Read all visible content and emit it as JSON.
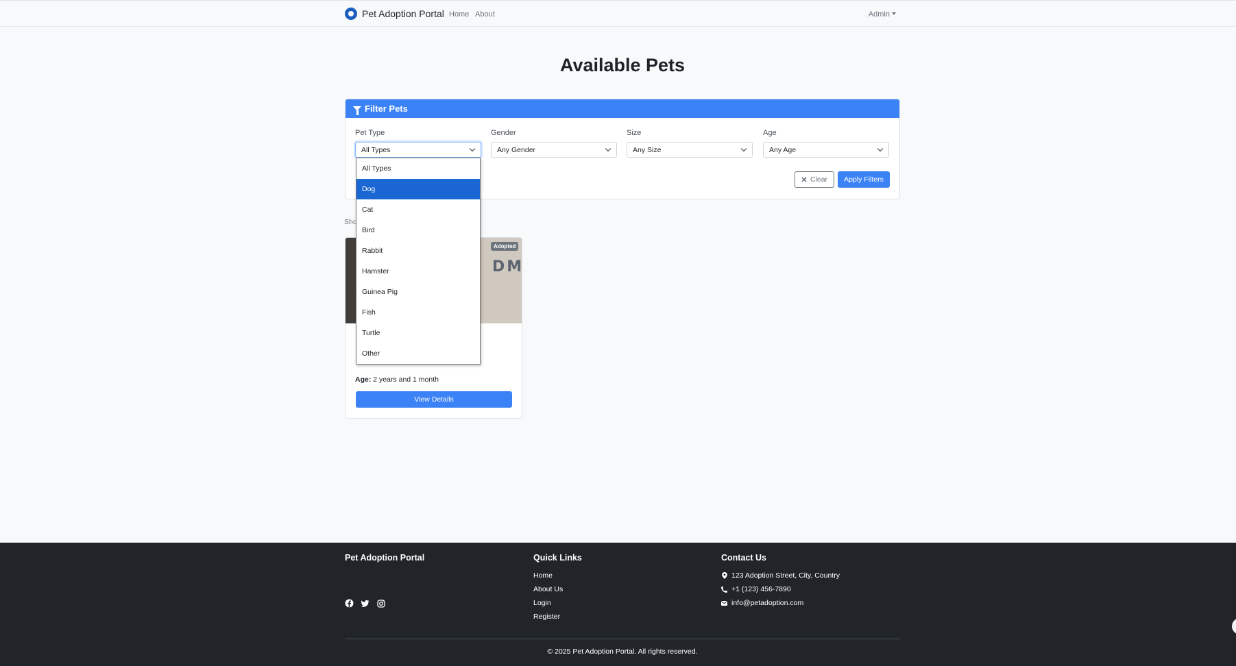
{
  "nav": {
    "brand": "Pet Adoption Portal",
    "links": [
      "Home",
      "About"
    ],
    "user_menu": "Admin"
  },
  "page": {
    "title": "Available Pets"
  },
  "filter": {
    "header": "Filter Pets",
    "fields": [
      {
        "label": "Pet Type",
        "value": "All Types"
      },
      {
        "label": "Gender",
        "value": "Any Gender"
      },
      {
        "label": "Size",
        "value": "Any Size"
      },
      {
        "label": "Age",
        "value": "Any Age"
      }
    ],
    "clear_label": "Clear",
    "apply_label": "Apply Filters"
  },
  "results": {
    "showing_text": "Sho"
  },
  "pet_card": {
    "badge": "Adopted",
    "image_text": "DM",
    "age_label": "Age:",
    "age_value": "2 years and 1 month",
    "button": "View Details"
  },
  "pet_type_options": {
    "items": [
      "All Types",
      "Dog",
      "Cat",
      "Bird",
      "Rabbit",
      "Hamster",
      "Guinea Pig",
      "Fish",
      "Turtle",
      "Other"
    ],
    "highlighted": "Dog"
  },
  "footer": {
    "brand": "Pet Adoption Portal",
    "quick_links_title": "Quick Links",
    "quick_links": [
      "Home",
      "About Us",
      "Login",
      "Register"
    ],
    "contact_title": "Contact Us",
    "address": "123 Adoption Street, City, Country",
    "phone": "+1 (123) 456-7890",
    "email": "info@petadoption.com",
    "copyright": "© 2025 Pet Adoption Portal. All rights reserved.",
    "social_icons": [
      "facebook-icon",
      "twitter-icon",
      "instagram-icon"
    ]
  },
  "colors": {
    "primary": "#3b82f6",
    "footer_bg": "#212529",
    "highlight": "#1a66d2"
  }
}
